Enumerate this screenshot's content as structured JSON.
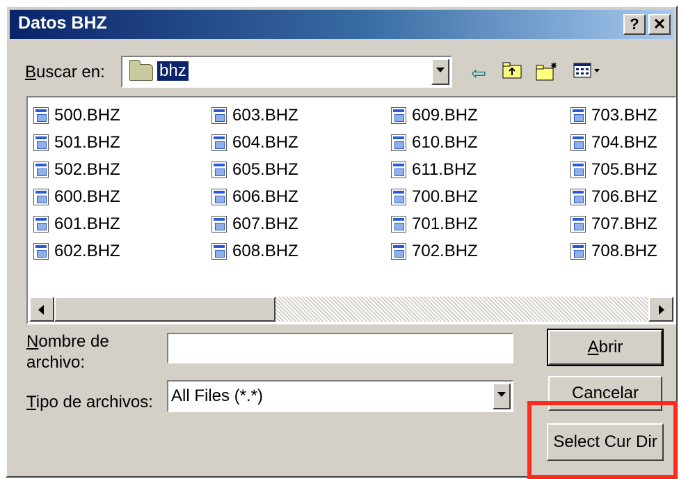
{
  "window": {
    "title": "Datos BHZ",
    "help_label": "?",
    "close_label": "✕"
  },
  "look_in": {
    "label_underlined": "B",
    "label_rest": "uscar en:",
    "value": "bhz"
  },
  "toolbar": {
    "back_icon": "back-arrow-icon",
    "up_icon": "up-folder-icon",
    "new_folder_icon": "new-folder-icon",
    "view_icon": "view-menu-icon"
  },
  "files": [
    [
      "500.BHZ",
      "501.BHZ",
      "502.BHZ",
      "600.BHZ",
      "601.BHZ",
      "602.BHZ"
    ],
    [
      "603.BHZ",
      "604.BHZ",
      "605.BHZ",
      "606.BHZ",
      "607.BHZ",
      "608.BHZ"
    ],
    [
      "609.BHZ",
      "610.BHZ",
      "611.BHZ",
      "700.BHZ",
      "701.BHZ",
      "702.BHZ"
    ],
    [
      "703.BHZ",
      "704.BHZ",
      "705.BHZ",
      "706.BHZ",
      "707.BHZ",
      "708.BHZ"
    ]
  ],
  "filename": {
    "label_underlined": "N",
    "label_rest_1": "ombre de",
    "label_line2": "archivo:",
    "value": ""
  },
  "filetype": {
    "label_underlined": "T",
    "label_rest": "ipo de archivos:",
    "value": "All Files (*.*)"
  },
  "buttons": {
    "open_underlined": "A",
    "open_rest": "brir",
    "cancel": "Cancelar",
    "select_cur_dir": "Select Cur Dir"
  },
  "colors": {
    "title_bar_start": "#0a246a",
    "dialog_face": "#d4d0c8",
    "annotation": "#ff2a1a"
  }
}
